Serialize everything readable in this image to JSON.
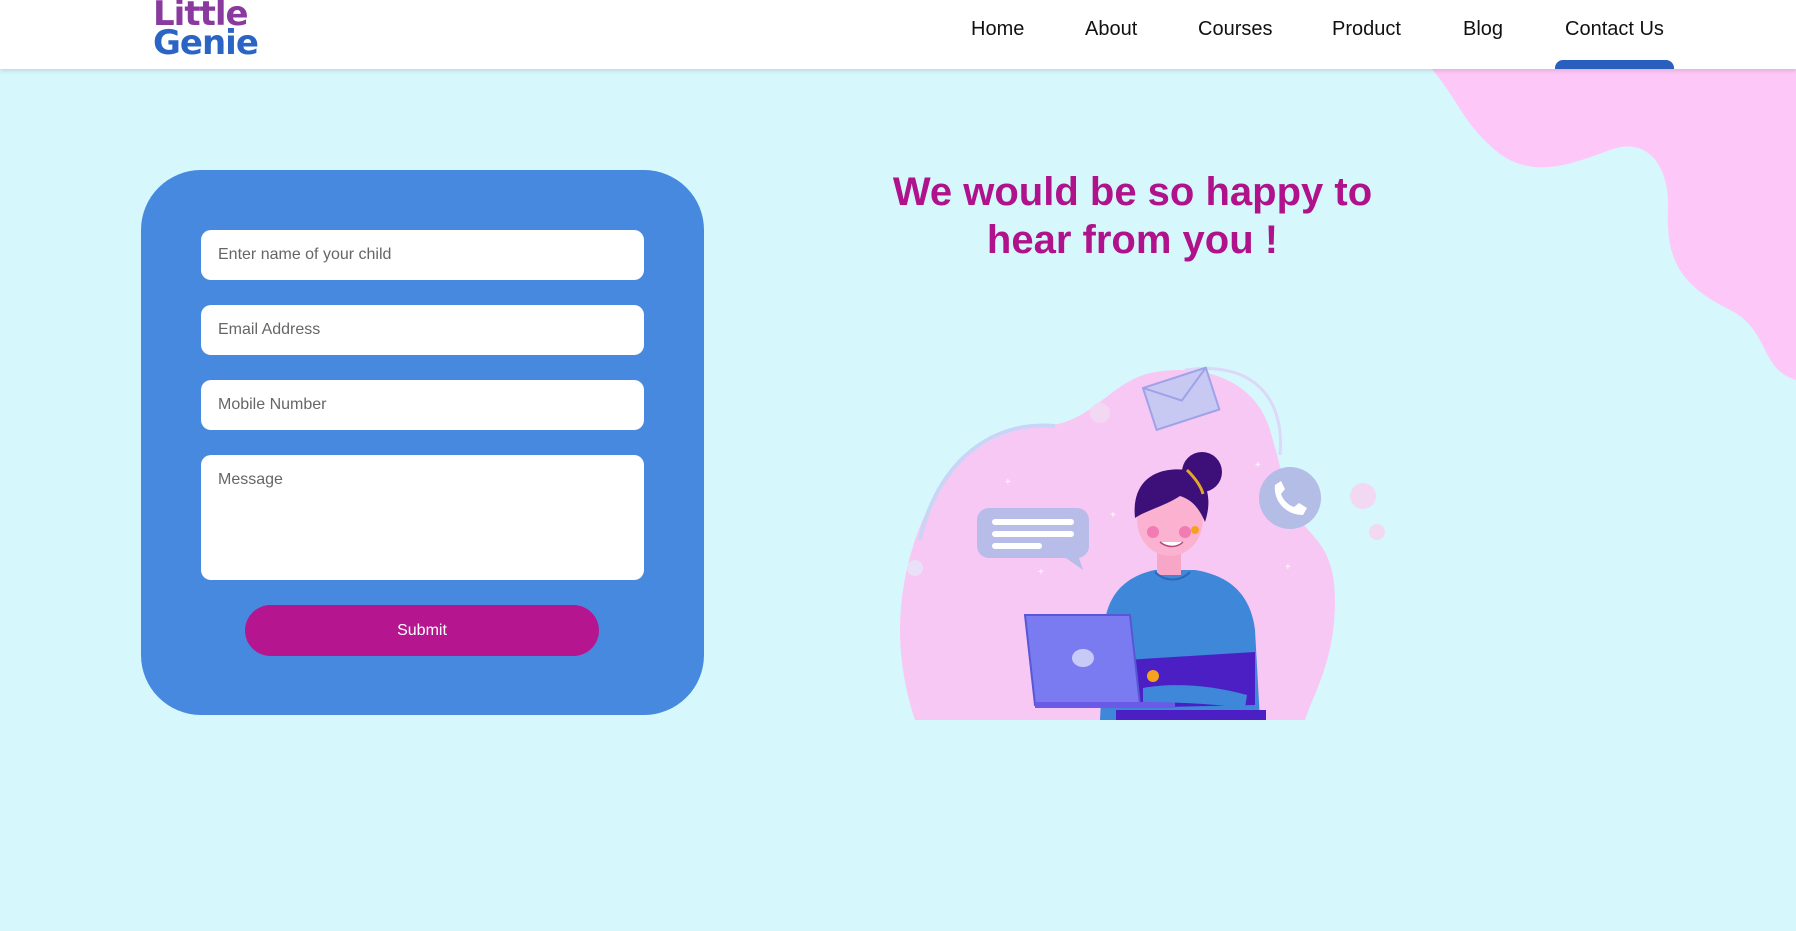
{
  "brand": {
    "logo_line1": "Little",
    "logo_line2": "Genie",
    "color_purple": "#8a3a9e",
    "color_blue": "#2a64c4"
  },
  "nav": {
    "items": [
      {
        "label": "Home"
      },
      {
        "label": "About"
      },
      {
        "label": "Courses"
      },
      {
        "label": "Product"
      },
      {
        "label": "Blog"
      },
      {
        "label": "Contact Us",
        "active": true
      }
    ]
  },
  "form": {
    "child_name_placeholder": "Enter name of your child",
    "email_placeholder": "Email Address",
    "mobile_placeholder": "Mobile Number",
    "message_placeholder": "Message",
    "submit_label": "Submit"
  },
  "content": {
    "headline_line1": "We would be so happy to",
    "headline_line2": "hear from you !"
  },
  "colors": {
    "page_bg": "#d6f8fd",
    "card_bg": "#4889e0",
    "accent_magenta": "#b5168f",
    "blob_pink": "#fdc8f8"
  }
}
